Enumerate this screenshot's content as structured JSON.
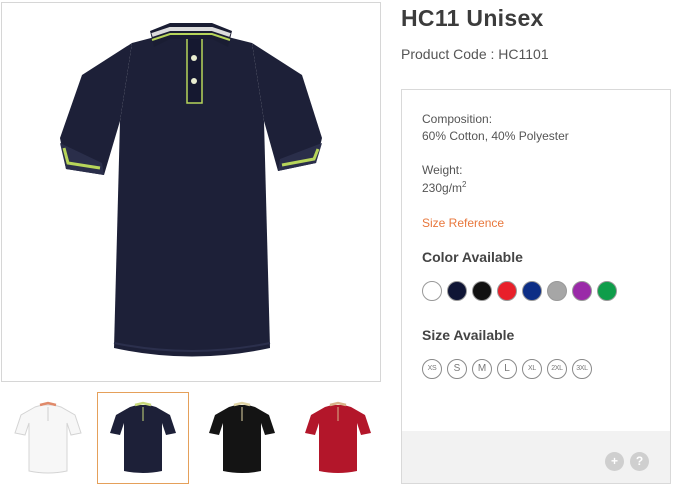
{
  "product": {
    "title": "HC11 Unisex",
    "code_label": "Product Code : HC1101"
  },
  "details": {
    "composition_label": "Composition:",
    "composition_value": "60% Cotton, 40% Polyester",
    "weight_label": "Weight:",
    "weight_value": "230g/m",
    "weight_sup": "2",
    "size_reference": "Size Reference"
  },
  "colors": {
    "heading": "Color Available",
    "swatches": [
      "#ffffff",
      "#0f1535",
      "#111111",
      "#e8202a",
      "#0d2e86",
      "#a6a6a6",
      "#9a2aa8",
      "#0f9d4a"
    ]
  },
  "sizes": {
    "heading": "Size Available",
    "items": [
      "XS",
      "S",
      "M",
      "L",
      "XL",
      "2XL",
      "3XL"
    ]
  },
  "gallery": {
    "main_color": "#1d2038",
    "thumbnails": [
      {
        "body": "#f7f7f7",
        "trim": "#e08a6a"
      },
      {
        "body": "#1d2038",
        "trim": "#c8d97a"
      },
      {
        "body": "#141414",
        "trim": "#e2d6a6"
      },
      {
        "body": "#b3162a",
        "trim": "#d9b48a"
      }
    ],
    "selected_index": 1
  },
  "footer": {
    "zoom_symbol": "+",
    "help_symbol": "?"
  }
}
